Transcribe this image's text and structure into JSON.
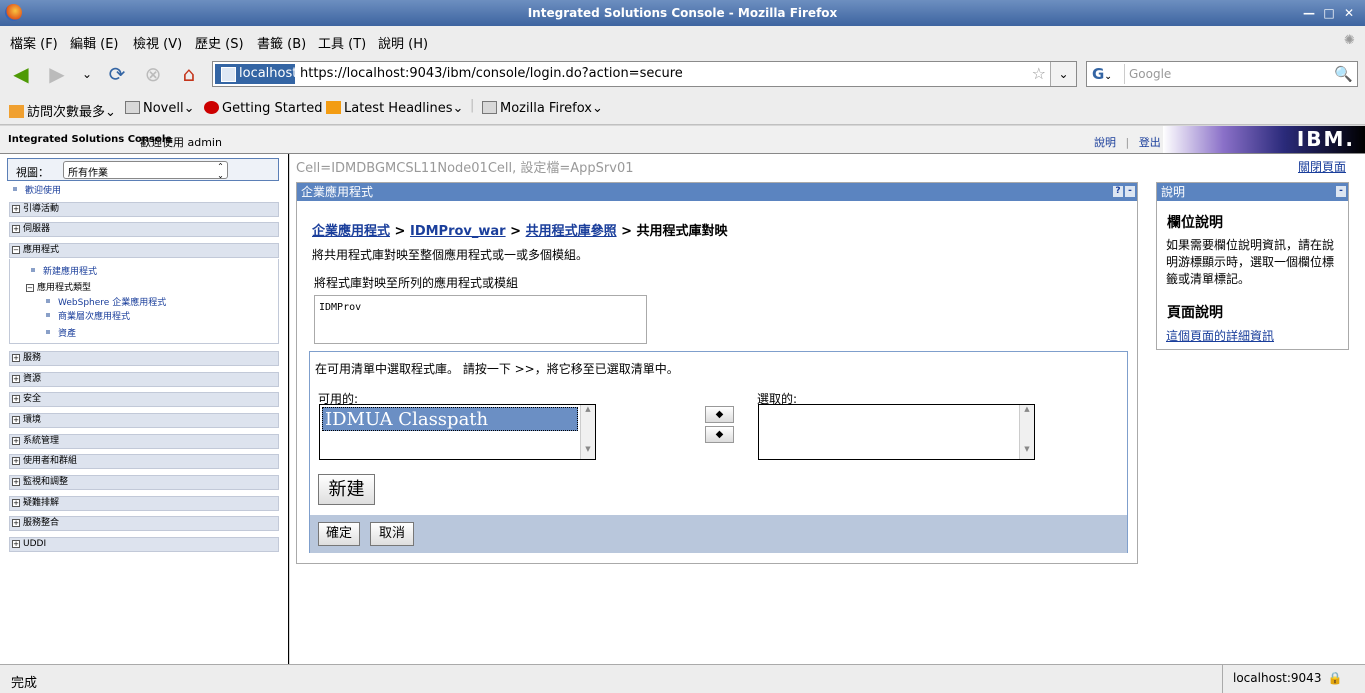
{
  "window": {
    "title": "Integrated Solutions Console - Mozilla Firefox"
  },
  "menu": [
    "檔案 (F)",
    "編輯 (E)",
    "檢視 (V)",
    "歷史 (S)",
    "書籤 (B)",
    "工具 (T)",
    "說明 (H)"
  ],
  "nav": {
    "site": "localhost",
    "url": "https://localhost:9043/ibm/console/login.do?action=secure",
    "search_placeholder": "Google",
    "search_engine": "G"
  },
  "bookmarks": [
    "訪問次數最多",
    "Novell",
    "Getting  Started",
    "Latest  Headlines",
    "Mozilla  Firefox"
  ],
  "isc": {
    "brand": "Integrated Solutions Console",
    "welcome": "歡迎使用  admin",
    "help_link": "說明",
    "separator": "|",
    "logout_link": "登出",
    "logo": "IBM."
  },
  "left": {
    "view_label": "視圖：",
    "view_value": "所有作業",
    "welcome_link": "歡迎使用",
    "categories_top": [
      "引導活動",
      "伺服器",
      "應用程式"
    ],
    "app_links": [
      "新建應用程式"
    ],
    "app_type": "應用程式類型",
    "app_type_links": [
      "WebSphere 企業應用程式",
      "商業層次應用程式",
      "資產"
    ],
    "categories_bottom": [
      "服務",
      "資源",
      "安全",
      "環境",
      "系統管理",
      "使用者和群組",
      "監視和調整",
      "疑難排解",
      "服務整合",
      "UDDI"
    ]
  },
  "main": {
    "cell": "Cell=IDMDBGMCSL11Node01Cell, 設定檔=AppSrv01",
    "close_page": "關閉頁面",
    "portlet_title": "企業應用程式",
    "portlet_help": "?",
    "portlet_min": "-",
    "breadcrumb": {
      "l1": "企業應用程式",
      "l2": "IDMProv_war",
      "l3": "共用程式庫參照",
      "sep": ">",
      "current": "共用程式庫對映"
    },
    "description": "將共用程式庫對映至整個應用程式或一或多個模組。",
    "map_label": "將程式庫對映至所列的應用程式或模組",
    "target": "IDMProv",
    "instruction": "在可用清單中選取程式庫。 請按一下 >>，將它移至已選取清單中。",
    "available_label": "可用的:",
    "available_items": [
      "IDMUA Classpath"
    ],
    "selected_label": "選取的:",
    "add_arrow": "◆",
    "remove_arrow": "◆",
    "new_button": "新建",
    "ok_button": "確定",
    "cancel_button": "取消"
  },
  "help": {
    "title": "說明",
    "field_help_title": "欄位說明",
    "field_help_text": "如果需要欄位說明資訊，請在說明游標顯示時，選取一個欄位標籤或清單標記。",
    "page_help_title": "頁面說明",
    "page_help_link": "這個頁面的詳細資訊"
  },
  "status": {
    "text": "完成",
    "host": "localhost:9043"
  }
}
